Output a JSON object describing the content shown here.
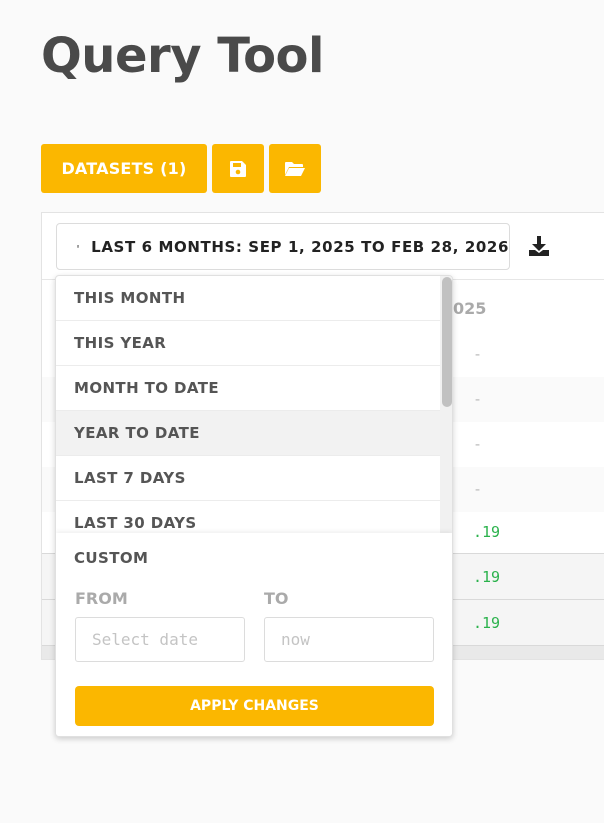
{
  "page": {
    "title": "Query Tool"
  },
  "toolbar": {
    "datasets_label": "DATASETS (1)",
    "save_icon": "floppy-disk-icon",
    "open_icon": "folder-open-icon",
    "accent": "#fbb700"
  },
  "date_range": {
    "label": "LAST 6 MONTHS: SEP 1, 2025 TO FEB 28, 2026",
    "icon": "calendar-icon"
  },
  "download_icon": "download-icon",
  "table": {
    "column_header_fragment": "025",
    "rows": [
      {
        "value": "-"
      },
      {
        "value": "-"
      },
      {
        "value": "-"
      },
      {
        "value": "-"
      },
      {
        "value": ".19"
      },
      {
        "value": ".19"
      },
      {
        "value": ".19"
      }
    ]
  },
  "dropdown": {
    "options": [
      "THIS MONTH",
      "THIS YEAR",
      "MONTH TO DATE",
      "YEAR TO DATE",
      "LAST 7 DAYS",
      "LAST 30 DAYS"
    ],
    "active_option": "YEAR TO DATE",
    "custom": {
      "title": "CUSTOM",
      "from_label": "FROM",
      "to_label": "TO",
      "from_placeholder": "Select date",
      "to_placeholder": "now",
      "apply_label": "APPLY CHANGES"
    }
  }
}
